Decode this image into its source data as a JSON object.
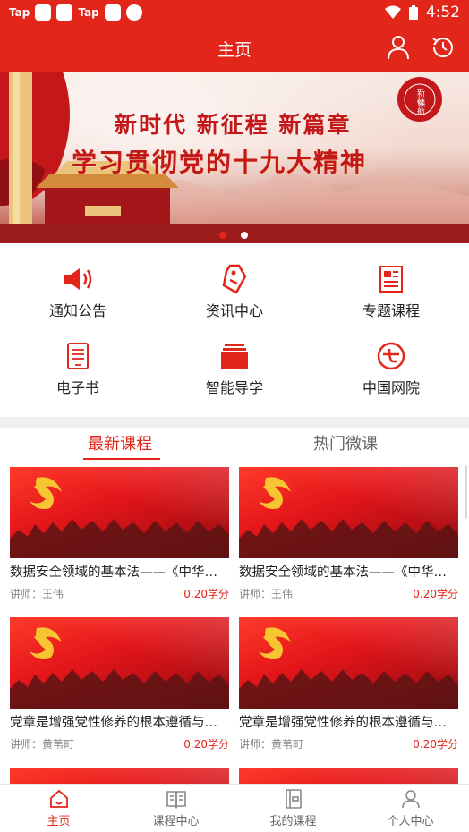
{
  "status_bar": {
    "left_labels": [
      "Tap",
      "Tap"
    ],
    "time": "4:52"
  },
  "header": {
    "title": "主页",
    "icons": [
      "user-icon",
      "history-clock-icon"
    ]
  },
  "banner": {
    "line1": "新时代 新征程 新篇章",
    "line2": "学习贯彻党的十九大精神",
    "seal_text": "新征程领航",
    "slide_count": 2,
    "active_slide": 1
  },
  "menu": {
    "items": [
      {
        "label": "通知公告",
        "icon": "megaphone-icon"
      },
      {
        "label": "资讯中心",
        "icon": "tag-icon"
      },
      {
        "label": "专题课程",
        "icon": "document-icon"
      },
      {
        "label": "电子书",
        "icon": "ebook-icon"
      },
      {
        "label": "智能导学",
        "icon": "stack-icon"
      },
      {
        "label": "中国网院",
        "icon": "china-net-icon"
      }
    ]
  },
  "tabs": {
    "items": [
      {
        "label": "最新课程",
        "active": true
      },
      {
        "label": "热门微课",
        "active": false
      }
    ]
  },
  "courses": [
    {
      "title": "数据安全领域的基本法——《中华人民共和国数据安全法》解读",
      "teacher": "讲师：王伟",
      "credit": "0.20学分"
    },
    {
      "title": "数据安全领域的基本法——《中华人民共和国数据安全法》解读",
      "teacher": "讲师：王伟",
      "credit": "0.20学分"
    },
    {
      "title": "党章是增强党性修养的根本遵循与行动指南",
      "teacher": "讲师：黄苇町",
      "credit": "0.20学分"
    },
    {
      "title": "党章是增强党性修养的根本遵循与行动指南",
      "teacher": "讲师：黄苇町",
      "credit": "0.20学分"
    },
    {
      "title": "",
      "teacher": "",
      "credit": ""
    },
    {
      "title": "",
      "teacher": "",
      "credit": ""
    }
  ],
  "bottom_nav": {
    "items": [
      {
        "label": "主页",
        "icon": "home-icon",
        "active": true
      },
      {
        "label": "课程中心",
        "icon": "book-icon",
        "active": false
      },
      {
        "label": "我的课程",
        "icon": "notebook-icon",
        "active": false
      },
      {
        "label": "个人中心",
        "icon": "person-icon",
        "active": false
      }
    ]
  },
  "colors": {
    "brand_red": "#e3261a",
    "text_dark": "#222222",
    "text_muted": "#888888"
  }
}
